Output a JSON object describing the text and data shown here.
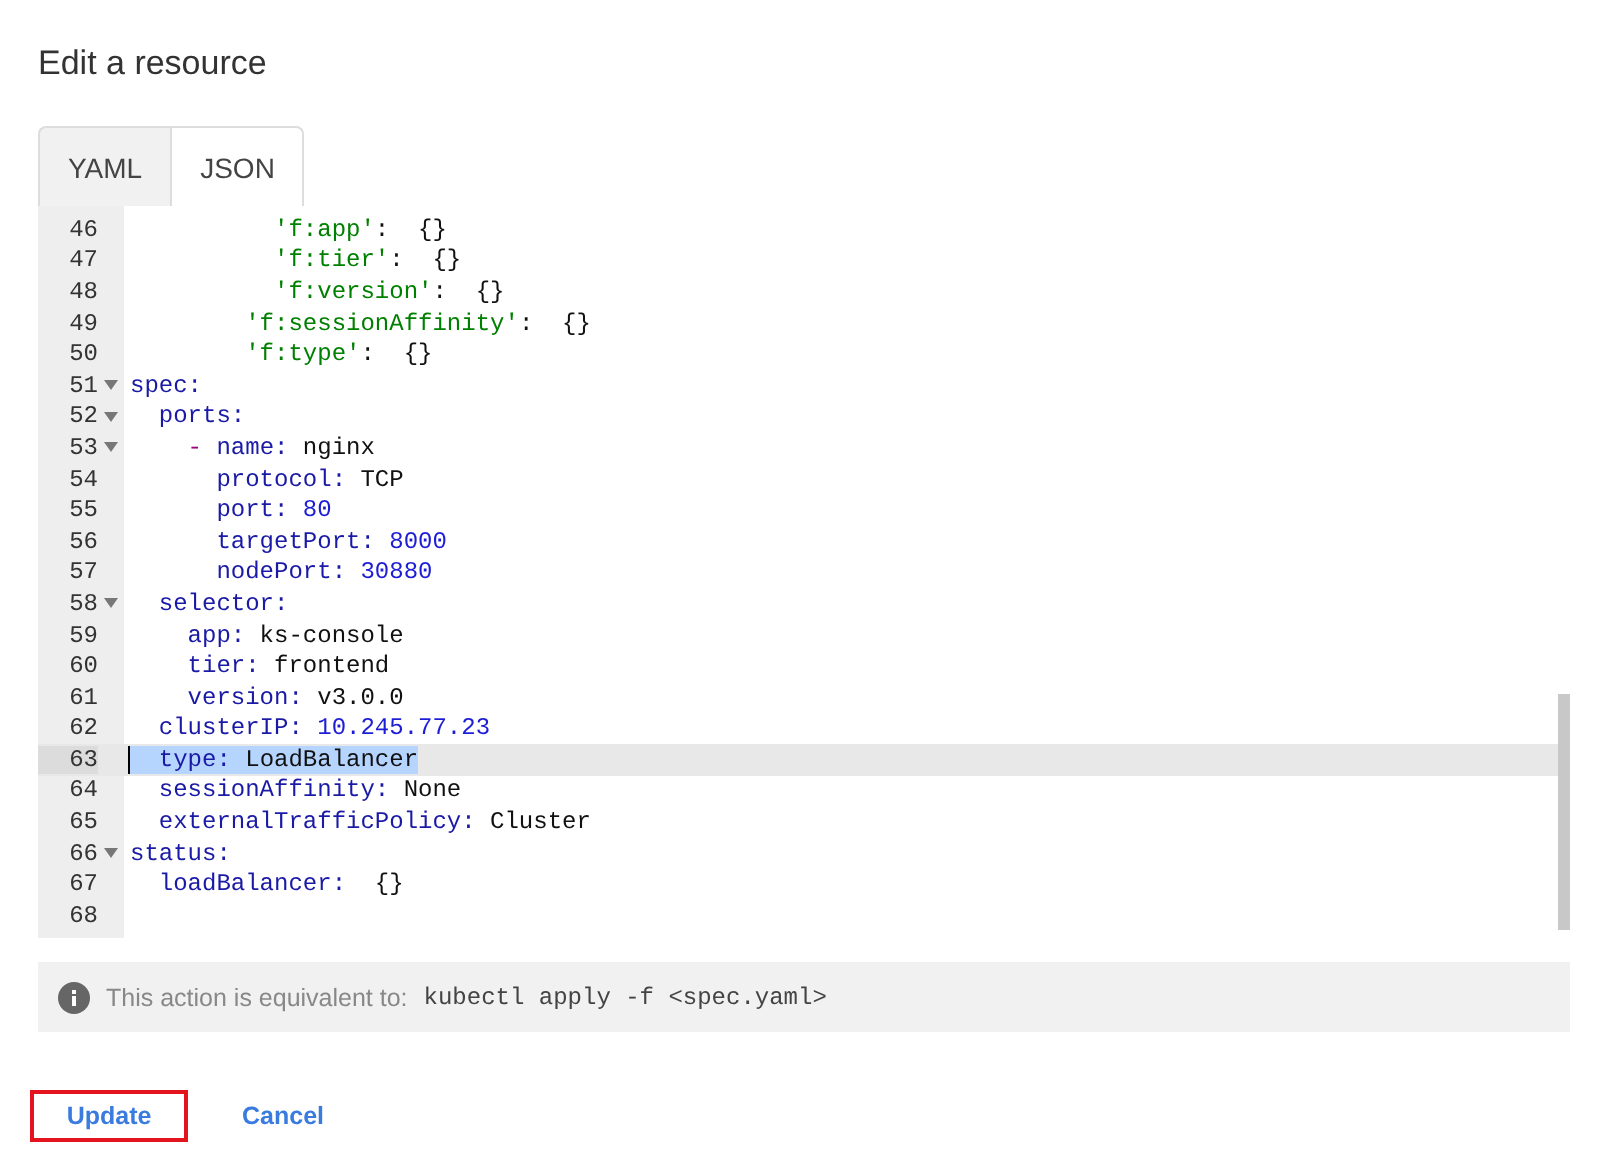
{
  "title": "Edit a resource",
  "tabs": [
    {
      "label": "YAML",
      "selected": false
    },
    {
      "label": "JSON",
      "selected": true
    }
  ],
  "editor": {
    "lines": [
      {
        "number": "46",
        "foldable": false,
        "selected": false,
        "parts": [
          {
            "kind": "string-key",
            "text": "          'f:app'"
          },
          {
            "kind": "punct",
            "text": ":  {}"
          }
        ]
      },
      {
        "number": "47",
        "foldable": false,
        "selected": false,
        "parts": [
          {
            "kind": "string-key",
            "text": "          'f:tier'"
          },
          {
            "kind": "punct",
            "text": ":  {}"
          }
        ]
      },
      {
        "number": "48",
        "foldable": false,
        "selected": false,
        "parts": [
          {
            "kind": "string-key",
            "text": "          'f:version'"
          },
          {
            "kind": "punct",
            "text": ":  {}"
          }
        ]
      },
      {
        "number": "49",
        "foldable": false,
        "selected": false,
        "parts": [
          {
            "kind": "string-key",
            "text": "        'f:sessionAffinity'"
          },
          {
            "kind": "punct",
            "text": ":  {}"
          }
        ]
      },
      {
        "number": "50",
        "foldable": false,
        "selected": false,
        "parts": [
          {
            "kind": "string-key",
            "text": "        'f:type'"
          },
          {
            "kind": "punct",
            "text": ":  {}"
          }
        ]
      },
      {
        "number": "51",
        "foldable": true,
        "selected": false,
        "parts": [
          {
            "kind": "key",
            "text": "spec:"
          }
        ]
      },
      {
        "number": "52",
        "foldable": true,
        "selected": false,
        "parts": [
          {
            "kind": "key",
            "text": "  ports:"
          }
        ]
      },
      {
        "number": "53",
        "foldable": true,
        "selected": false,
        "parts": [
          {
            "kind": "dash",
            "text": "    -"
          },
          {
            "kind": "key",
            "text": " name:"
          },
          {
            "kind": "text",
            "text": " nginx"
          }
        ]
      },
      {
        "number": "54",
        "foldable": false,
        "selected": false,
        "parts": [
          {
            "kind": "key",
            "text": "      protocol:"
          },
          {
            "kind": "text",
            "text": " TCP"
          }
        ]
      },
      {
        "number": "55",
        "foldable": false,
        "selected": false,
        "parts": [
          {
            "kind": "key",
            "text": "      port:"
          },
          {
            "kind": "number",
            "text": " 80"
          }
        ]
      },
      {
        "number": "56",
        "foldable": false,
        "selected": false,
        "parts": [
          {
            "kind": "key",
            "text": "      targetPort:"
          },
          {
            "kind": "number",
            "text": " 8000"
          }
        ]
      },
      {
        "number": "57",
        "foldable": false,
        "selected": false,
        "parts": [
          {
            "kind": "key",
            "text": "      nodePort:"
          },
          {
            "kind": "number",
            "text": " 30880"
          }
        ]
      },
      {
        "number": "58",
        "foldable": true,
        "selected": false,
        "parts": [
          {
            "kind": "key",
            "text": "  selector:"
          }
        ]
      },
      {
        "number": "59",
        "foldable": false,
        "selected": false,
        "parts": [
          {
            "kind": "key",
            "text": "    app:"
          },
          {
            "kind": "text",
            "text": " ks-console"
          }
        ]
      },
      {
        "number": "60",
        "foldable": false,
        "selected": false,
        "parts": [
          {
            "kind": "key",
            "text": "    tier:"
          },
          {
            "kind": "text",
            "text": " frontend"
          }
        ]
      },
      {
        "number": "61",
        "foldable": false,
        "selected": false,
        "parts": [
          {
            "kind": "key",
            "text": "    version:"
          },
          {
            "kind": "text",
            "text": " v3.0.0"
          }
        ]
      },
      {
        "number": "62",
        "foldable": false,
        "selected": false,
        "parts": [
          {
            "kind": "key",
            "text": "  clusterIP:"
          },
          {
            "kind": "number",
            "text": " 10.245.77.23"
          }
        ]
      },
      {
        "number": "63",
        "foldable": false,
        "selected": true,
        "parts": [
          {
            "kind": "key",
            "text": "  type:"
          },
          {
            "kind": "text",
            "text": " LoadBalancer"
          }
        ]
      },
      {
        "number": "64",
        "foldable": false,
        "selected": false,
        "parts": [
          {
            "kind": "key",
            "text": "  sessionAffinity:"
          },
          {
            "kind": "text",
            "text": " None"
          }
        ]
      },
      {
        "number": "65",
        "foldable": false,
        "selected": false,
        "parts": [
          {
            "kind": "key",
            "text": "  externalTrafficPolicy:"
          },
          {
            "kind": "text",
            "text": " Cluster"
          }
        ]
      },
      {
        "number": "66",
        "foldable": true,
        "selected": false,
        "parts": [
          {
            "kind": "key",
            "text": "status:"
          }
        ]
      },
      {
        "number": "67",
        "foldable": false,
        "selected": false,
        "parts": [
          {
            "kind": "key",
            "text": "  loadBalancer:"
          },
          {
            "kind": "punct",
            "text": "  {}"
          }
        ]
      },
      {
        "number": "68",
        "foldable": false,
        "selected": false
      }
    ]
  },
  "notice": {
    "text": "This action is equivalent to:",
    "command": "kubectl apply -f <spec.yaml>"
  },
  "buttons": [
    {
      "label": "Update",
      "focused": true
    },
    {
      "label": "Cancel",
      "focused": false
    }
  ]
}
